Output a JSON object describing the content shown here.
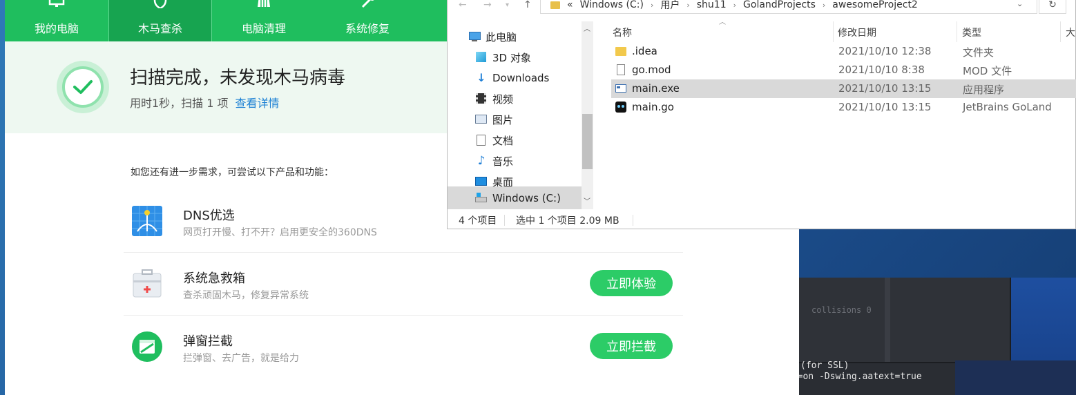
{
  "app360": {
    "tabs": [
      {
        "label": "我的电脑",
        "icon": "monitor-icon",
        "active": false
      },
      {
        "label": "木马查杀",
        "icon": "shield-icon",
        "active": true
      },
      {
        "label": "电脑清理",
        "icon": "broom-icon",
        "active": false
      },
      {
        "label": "系统修复",
        "icon": "wrench-icon",
        "active": false
      }
    ],
    "banner": {
      "title": "扫描完成，未发现木马病毒",
      "sub": "用时1秒，扫描 1 项",
      "link": "查看详情"
    },
    "suggest_title": "如您还有进一步需求，可尝试以下产品和功能：",
    "products": [
      {
        "name": "DNS优选",
        "desc": "网页打开慢、打不开？启用更安全的360DNS",
        "button": "",
        "icon": "globe-icon"
      },
      {
        "name": "系统急救箱",
        "desc": "查杀顽固木马，修复异常系统",
        "button": "立即体验",
        "icon": "first-aid-icon"
      },
      {
        "name": "弹窗拦截",
        "desc": "拦弹窗、去广告，就是给力",
        "button": "立即拦截",
        "icon": "popup-block-icon"
      }
    ],
    "colors": {
      "green": "#1fbe5e",
      "button_green": "#2ccc67"
    }
  },
  "explorer": {
    "address": [
      "«",
      "Windows (C:)",
      "用户",
      "shu11",
      "GolandProjects",
      "awesomeProject2"
    ],
    "nav_items": [
      {
        "label": "此电脑",
        "icon": "computer-icon"
      },
      {
        "label": "3D 对象",
        "icon": "cube-icon"
      },
      {
        "label": "Downloads",
        "icon": "download-icon"
      },
      {
        "label": "视频",
        "icon": "video-icon"
      },
      {
        "label": "图片",
        "icon": "picture-icon"
      },
      {
        "label": "文档",
        "icon": "document-icon"
      },
      {
        "label": "音乐",
        "icon": "music-icon"
      },
      {
        "label": "桌面",
        "icon": "desktop-icon"
      },
      {
        "label": "Windows (C:)",
        "icon": "drive-icon"
      }
    ],
    "columns": {
      "name": "名称",
      "date": "修改日期",
      "type": "类型",
      "size": "大"
    },
    "files": [
      {
        "name": ".idea",
        "date": "2021/10/10 12:38",
        "type": "文件夹",
        "icon": "folder-icon"
      },
      {
        "name": "go.mod",
        "date": "2021/10/10 8:38",
        "type": "MOD 文件",
        "icon": "file-icon"
      },
      {
        "name": "main.exe",
        "date": "2021/10/10 13:15",
        "type": "应用程序",
        "icon": "exe-icon"
      },
      {
        "name": "main.go",
        "date": "2021/10/10 13:15",
        "type": "JetBrains GoLand",
        "icon": "go-icon"
      }
    ],
    "status": {
      "count": "4 个项目",
      "selected": "选中 1 个项目  2.09 MB"
    }
  },
  "terminal": {
    "dim_line": "collisions 0",
    "line1": "(for SSL)",
    "line2": "gs=on -Dswing.aatext=true"
  }
}
